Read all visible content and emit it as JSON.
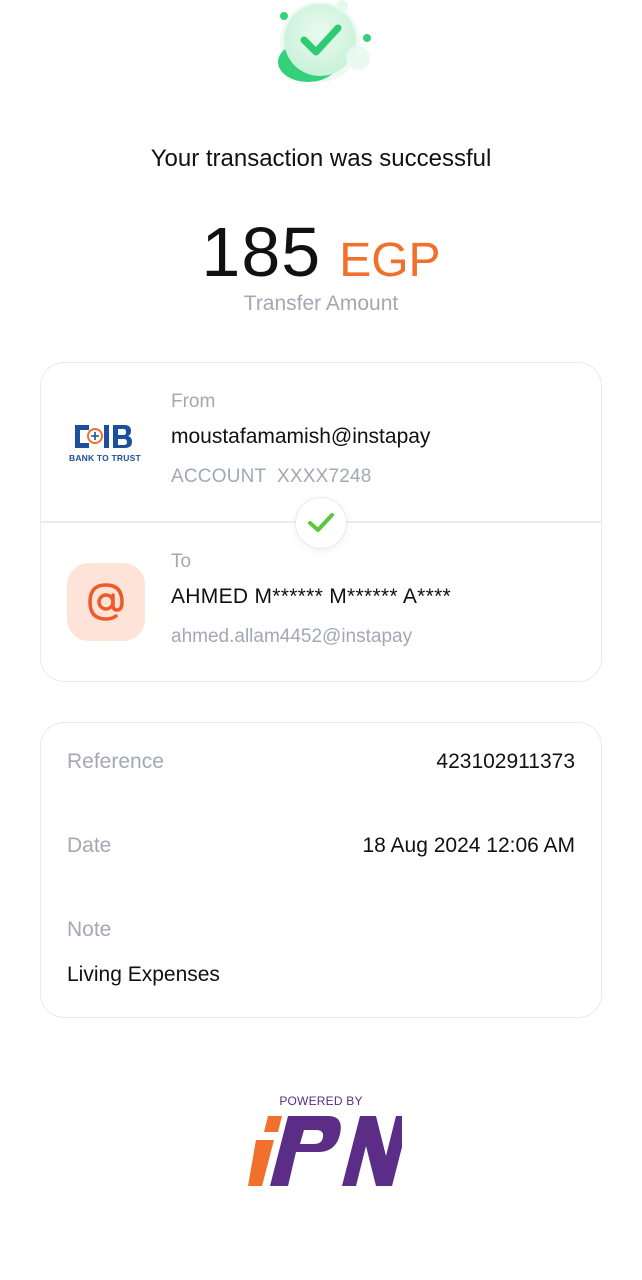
{
  "status": {
    "headline": "Your transaction was successful",
    "icon": "success-check-icon",
    "accent_color": "#2ecc71"
  },
  "amount": {
    "value": "185",
    "currency": "EGP",
    "label": "Transfer Amount",
    "currency_color": "#f0702c"
  },
  "from": {
    "label": "From",
    "bank_logo_text": "CIB",
    "bank_tagline": "BANK TO TRUST",
    "handle": "moustafamamish@instapay",
    "account": "ACCOUNT  XXXX7248"
  },
  "to": {
    "label": "To",
    "icon": "at-sign-icon",
    "name": "AHMED M****** M****** A****",
    "handle": "ahmed.allam4452@instapay"
  },
  "details": {
    "reference_label": "Reference",
    "reference_value": "423102911373",
    "date_label": "Date",
    "date_value": "18 Aug 2024 12:06 AM",
    "note_label": "Note",
    "note_value": "Living Expenses"
  },
  "footer": {
    "powered_by": "POWERED BY",
    "logo_text": "IPN",
    "logo_colors": [
      "#f0702c",
      "#5b2d86"
    ]
  }
}
